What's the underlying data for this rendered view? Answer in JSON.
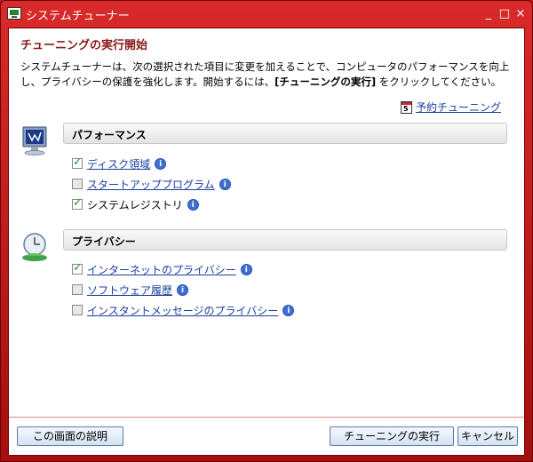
{
  "window": {
    "title": "システムチューナー",
    "controls": [
      "_",
      "□",
      "×"
    ]
  },
  "header": {
    "title": "チューニングの実行開始",
    "desc_part1": "システムチューナーは、次の選択された項目に変更を加えることで、コンピュータのパフォーマンスを向上し、プライバシーの保護を強化します。開始するには、",
    "desc_bold": "[チューニングの実行]",
    "desc_part2": " をクリックしてください。"
  },
  "schedule": {
    "label": "予約チューニング",
    "icon": "calendar-icon",
    "icon_text": "5"
  },
  "sections": {
    "performance": {
      "title": "パフォーマンス",
      "items": [
        {
          "label": "ディスク領域",
          "checked": true,
          "link": true
        },
        {
          "label": "スタートアッププログラム",
          "checked": false,
          "link": true
        },
        {
          "label": "システムレジストリ",
          "checked": true,
          "link": false
        }
      ]
    },
    "privacy": {
      "title": "プライバシー",
      "items": [
        {
          "label": "インターネットのプライバシー",
          "checked": true,
          "link": true
        },
        {
          "label": "ソフトウェア履歴",
          "checked": false,
          "link": true
        },
        {
          "label": "インスタントメッセージのプライバシー",
          "checked": false,
          "link": true
        }
      ]
    }
  },
  "footer": {
    "help_label": "この画面の説明",
    "run_label": "チューニングの実行",
    "cancel_label": "キャンセル"
  },
  "colors": {
    "titlebar": "#c62828",
    "heading": "#8a1a1a",
    "link": "#1a3fa0",
    "info": "#3d6fd6"
  }
}
